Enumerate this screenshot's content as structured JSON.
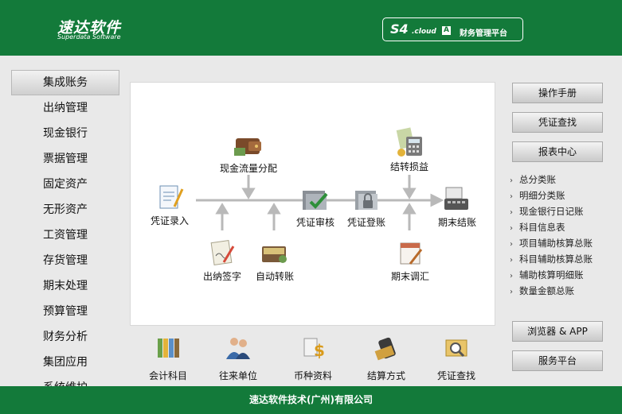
{
  "header": {
    "logo_cn": "速达软件",
    "logo_en": "Superdata Software",
    "brand_s4": "S4",
    "brand_cloud": ".cloud",
    "brand_badge": "A",
    "brand_title": "财务管理平台"
  },
  "sidebar": {
    "items": [
      {
        "label": "集成账务"
      },
      {
        "label": "出纳管理"
      },
      {
        "label": "现金银行"
      },
      {
        "label": "票据管理"
      },
      {
        "label": "固定资产"
      },
      {
        "label": "无形资产"
      },
      {
        "label": "工资管理"
      },
      {
        "label": "存货管理"
      },
      {
        "label": "期末处理"
      },
      {
        "label": "预算管理"
      },
      {
        "label": "财务分析"
      },
      {
        "label": "集团应用"
      },
      {
        "label": "系统维护"
      }
    ]
  },
  "flow": {
    "cash_flow": "现金流量分配",
    "transfer_pl": "结转损益",
    "voucher_entry": "凭证录入",
    "voucher_audit": "凭证审核",
    "voucher_post": "凭证登账",
    "period_close": "期末结账",
    "cashier_sign": "出纳签字",
    "auto_transfer": "自动转账",
    "period_adjust": "期末调汇"
  },
  "tools": {
    "accounts": "会计科目",
    "partners": "往来单位",
    "currency": "币种资料",
    "settlement": "结算方式",
    "voucher_query": "凭证查找"
  },
  "right": {
    "manual": "操作手册",
    "voucher_query": "凭证查找",
    "report_center": "报表中心",
    "reports": [
      "总分类账",
      "明细分类账",
      "现金银行日记账",
      "科目信息表",
      "项目辅助核算总账",
      "科目辅助核算总账",
      "辅助核算明细账",
      "数量金额总账"
    ],
    "browser_app": "浏览器 & APP",
    "service_platform": "服务平台"
  },
  "footer": {
    "company": "速达软件技术(广州)有限公司"
  },
  "colors": {
    "brand_green": "#137a3a",
    "background": "#e9e9e9"
  }
}
